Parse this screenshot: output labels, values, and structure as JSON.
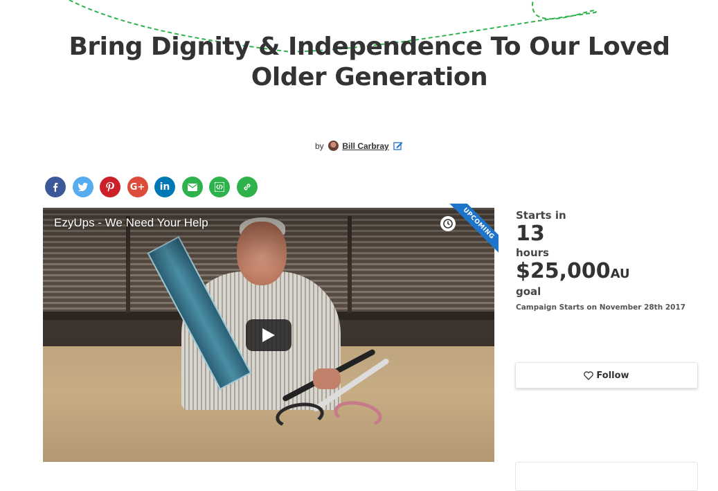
{
  "campaign": {
    "title": "Bring Dignity & Independence To Our Loved Older Generation",
    "by_label": "by",
    "author": "Bill Carbray"
  },
  "share": [
    {
      "name": "facebook",
      "color": "#3b5998"
    },
    {
      "name": "twitter",
      "color": "#55acee"
    },
    {
      "name": "pinterest",
      "color": "#cb2027"
    },
    {
      "name": "google-plus",
      "color": "#dd4b39"
    },
    {
      "name": "linkedin",
      "color": "#0077b5"
    },
    {
      "name": "email",
      "color": "#2eb24c"
    },
    {
      "name": "embed",
      "color": "#2eb24c"
    },
    {
      "name": "link",
      "color": "#2eb24c"
    }
  ],
  "video": {
    "title": "EzyUps - We Need Your Help",
    "ribbon": "UPCOMING"
  },
  "stats": {
    "starts_label": "Starts in",
    "starts_value": "13",
    "starts_unit": "hours",
    "goal_amount": "$25,000",
    "goal_currency": "AU",
    "goal_label": "goal",
    "start_note": "Campaign Starts on November 28th 2017"
  },
  "follow": {
    "label": "Follow"
  },
  "colors": {
    "accent_green": "#2eb24c",
    "ribbon_blue": "#1d74c9"
  }
}
